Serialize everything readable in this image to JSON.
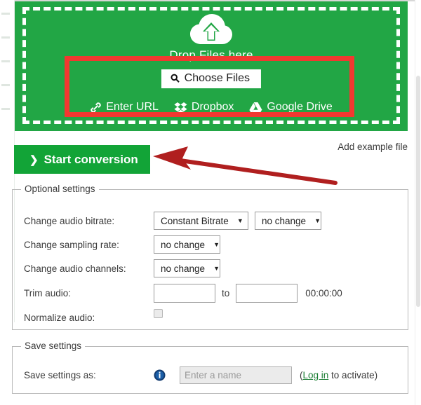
{
  "dropzone": {
    "cloud_icon": "cloud-upload-icon",
    "drop_label": "Drop Files here",
    "choose_files_label": "Choose Files",
    "choose_files_icon": "search-icon",
    "sources": [
      {
        "label": "Enter URL",
        "icon": "link-icon"
      },
      {
        "label": "Dropbox",
        "icon": "dropbox-icon"
      },
      {
        "label": "Google Drive",
        "icon": "google-drive-icon"
      }
    ],
    "highlight_color": "#f23830",
    "background_color": "#22a645"
  },
  "actions": {
    "start_conversion_label": "Start conversion",
    "start_conversion_chevron": "chevron-right-icon",
    "add_example_file_label": "Add example file",
    "arrow_annotation_color": "#b01f1f"
  },
  "optional_settings": {
    "legend": "Optional settings",
    "rows": [
      {
        "label": "Change audio bitrate:",
        "selects": [
          {
            "value": "Constant Bitrate",
            "caret": "▼"
          },
          {
            "value": "no change",
            "caret": "▼"
          }
        ]
      },
      {
        "label": "Change sampling rate:",
        "selects": [
          {
            "value": "no change",
            "caret": "▼"
          }
        ]
      },
      {
        "label": "Change audio channels:",
        "selects": [
          {
            "value": "no change",
            "caret": "▼"
          }
        ]
      }
    ],
    "trim": {
      "label": "Trim audio:",
      "from_value": "",
      "to_word": "to",
      "to_value": "",
      "duration": "00:00:00"
    },
    "normalize": {
      "label": "Normalize audio:",
      "checked": false
    }
  },
  "save_settings": {
    "legend": "Save settings",
    "label": "Save settings as:",
    "info_icon": "info-icon",
    "name_value": "",
    "name_placeholder": "Enter a name",
    "hint_prefix": "(",
    "login_link": "Log in",
    "hint_suffix": " to activate)"
  }
}
